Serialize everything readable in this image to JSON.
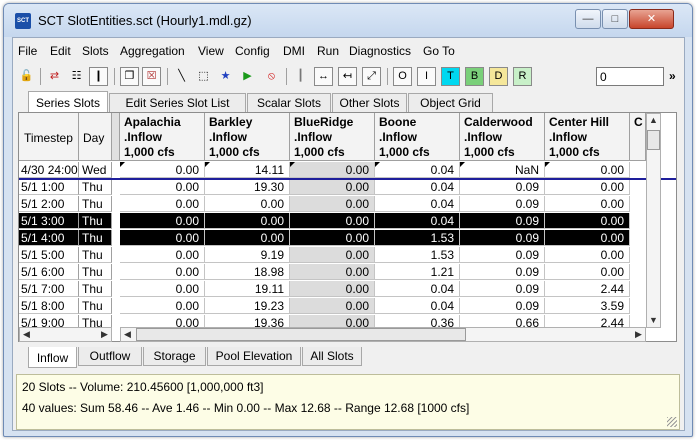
{
  "window": {
    "title": "SCT SlotEntities.sct (Hourly1.mdl.gz)",
    "icon": "SCT"
  },
  "window_controls": {
    "minimize": "—",
    "maximize": "□",
    "close": "✕"
  },
  "menu": [
    "File",
    "Edit",
    "Slots",
    "Aggregation",
    "View",
    "Config",
    "DMI",
    "Run",
    "Diagnostics",
    "Go To"
  ],
  "toolbar": {
    "icons": [
      "lock-icon",
      "edit-series-icon",
      "table-icon",
      "column-icon",
      "copy-icon",
      "delete-icon",
      "plot-icon",
      "select-icon",
      "run-figure-icon",
      "play-icon",
      "stop-icon",
      "column-guides-icon",
      "fit-icon",
      "compress-icon",
      "expand-icon"
    ],
    "letters": [
      "O",
      "I",
      "T",
      "B",
      "D",
      "R"
    ],
    "letter_colors": [
      "#ffffff",
      "#ffffff",
      "#00d8f0",
      "#7ad07a",
      "#f5e79a",
      "#c8f0c8"
    ],
    "value_input": "0",
    "more": "»"
  },
  "top_tabs": [
    "Series Slots",
    "Edit Series Slot List",
    "Scalar Slots",
    "Other Slots",
    "Object Grid"
  ],
  "grid": {
    "header_timestep": "Timestep",
    "header_day": "Day",
    "columns": [
      {
        "name": "Apalachia",
        "slot": ".Inflow",
        "units": "1,000 cfs"
      },
      {
        "name": "Barkley",
        "slot": ".Inflow",
        "units": "1,000 cfs"
      },
      {
        "name": "BlueRidge",
        "slot": ".Inflow",
        "units": "1,000 cfs"
      },
      {
        "name": "Boone",
        "slot": ".Inflow",
        "units": "1,000 cfs"
      },
      {
        "name": "Calderwood",
        "slot": ".Inflow",
        "units": "1,000 cfs"
      },
      {
        "name": "Center Hill",
        "slot": ".Inflow",
        "units": "1,000 cfs"
      }
    ],
    "partial_column_letter": "C",
    "rows": [
      {
        "timestep": "4/30 24:00",
        "day": "Wed",
        "values": [
          "0.00",
          "14.11",
          "0.00",
          "0.04",
          "NaN",
          "0.00"
        ],
        "selected": false
      },
      {
        "timestep": "5/1 1:00",
        "day": "Thu",
        "values": [
          "0.00",
          "19.30",
          "0.00",
          "0.04",
          "0.09",
          "0.00"
        ],
        "selected": false
      },
      {
        "timestep": "5/1 2:00",
        "day": "Thu",
        "values": [
          "0.00",
          "0.00",
          "0.00",
          "0.04",
          "0.09",
          "0.00"
        ],
        "selected": false
      },
      {
        "timestep": "5/1 3:00",
        "day": "Thu",
        "values": [
          "0.00",
          "0.00",
          "0.00",
          "0.04",
          "0.09",
          "0.00"
        ],
        "selected": true
      },
      {
        "timestep": "5/1 4:00",
        "day": "Thu",
        "values": [
          "0.00",
          "0.00",
          "0.00",
          "1.53",
          "0.09",
          "0.00"
        ],
        "selected": true
      },
      {
        "timestep": "5/1 5:00",
        "day": "Thu",
        "values": [
          "0.00",
          "9.19",
          "0.00",
          "1.53",
          "0.09",
          "0.00"
        ],
        "selected": false
      },
      {
        "timestep": "5/1 6:00",
        "day": "Thu",
        "values": [
          "0.00",
          "18.98",
          "0.00",
          "1.21",
          "0.09",
          "0.00"
        ],
        "selected": false
      },
      {
        "timestep": "5/1 7:00",
        "day": "Thu",
        "values": [
          "0.00",
          "19.11",
          "0.00",
          "0.04",
          "0.09",
          "2.44"
        ],
        "selected": false
      },
      {
        "timestep": "5/1 8:00",
        "day": "Thu",
        "values": [
          "0.00",
          "19.23",
          "0.00",
          "0.04",
          "0.09",
          "3.59"
        ],
        "selected": false
      },
      {
        "timestep": "5/1 9:00",
        "day": "Thu",
        "values": [
          "0.00",
          "19.36",
          "0.00",
          "0.36",
          "0.66",
          "2.44"
        ],
        "selected": false
      }
    ]
  },
  "bottom_tabs": [
    "Inflow",
    "Outflow",
    "Storage",
    "Pool Elevation",
    "All Slots"
  ],
  "status": {
    "line1": "20 Slots -- Volume: 210.45600 [1,000,000 ft3]",
    "line2": "40 values:  Sum 58.46 -- Ave 1.46 -- Min 0.00 -- Max 12.68 -- Range 12.68 [1000 cfs]"
  }
}
